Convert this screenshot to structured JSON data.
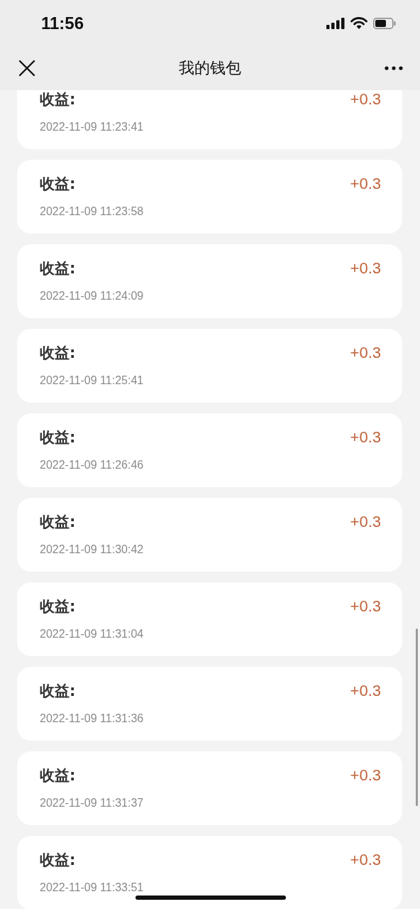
{
  "status_bar": {
    "time": "11:56"
  },
  "nav": {
    "title": "我的钱包"
  },
  "records": [
    {
      "label": "收益:",
      "amount": "+0.3",
      "time": "2022-11-09 11:23:41"
    },
    {
      "label": "收益:",
      "amount": "+0.3",
      "time": "2022-11-09 11:23:58"
    },
    {
      "label": "收益:",
      "amount": "+0.3",
      "time": "2022-11-09 11:24:09"
    },
    {
      "label": "收益:",
      "amount": "+0.3",
      "time": "2022-11-09 11:25:41"
    },
    {
      "label": "收益:",
      "amount": "+0.3",
      "time": "2022-11-09 11:26:46"
    },
    {
      "label": "收益:",
      "amount": "+0.3",
      "time": "2022-11-09 11:30:42"
    },
    {
      "label": "收益:",
      "amount": "+0.3",
      "time": "2022-11-09 11:31:04"
    },
    {
      "label": "收益:",
      "amount": "+0.3",
      "time": "2022-11-09 11:31:36"
    },
    {
      "label": "收益:",
      "amount": "+0.3",
      "time": "2022-11-09 11:31:37"
    },
    {
      "label": "收益:",
      "amount": "+0.3",
      "time": "2022-11-09 11:33:51"
    }
  ]
}
